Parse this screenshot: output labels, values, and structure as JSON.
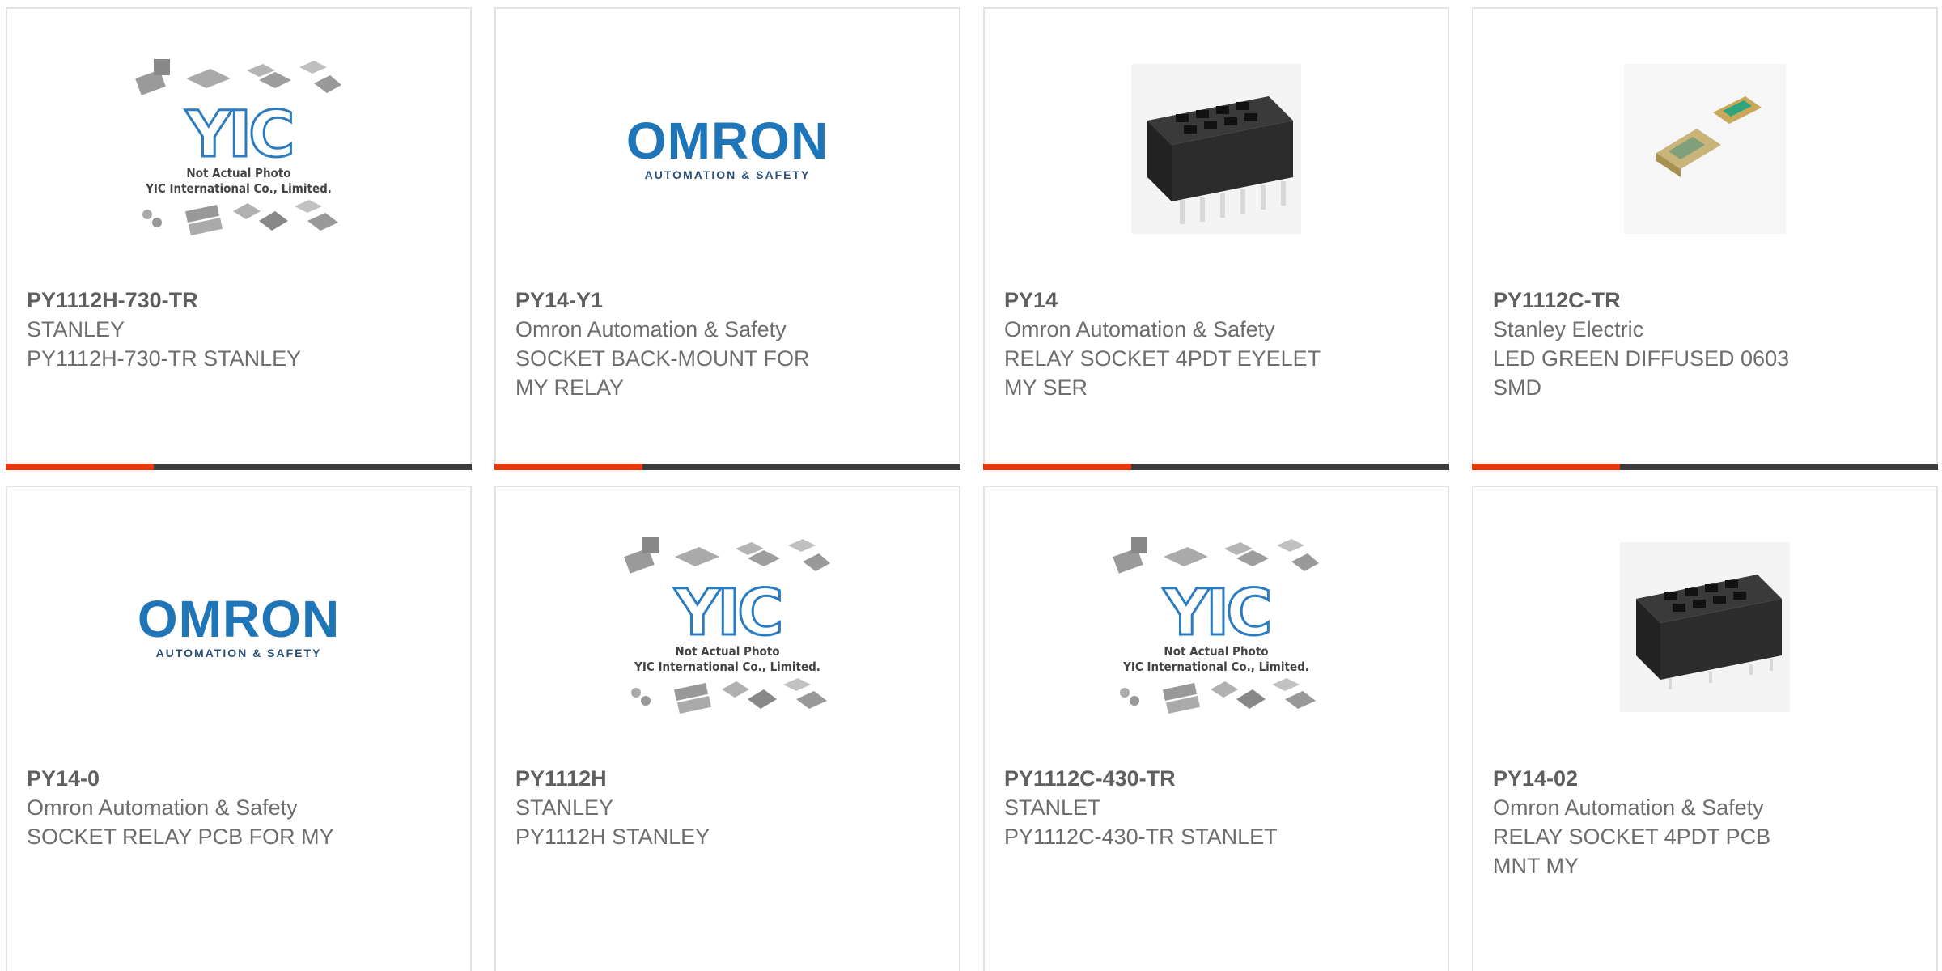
{
  "products": [
    {
      "part": "PY1112H-730-TR",
      "maker": "STANLEY",
      "desc1": "PY1112H-730-TR STANLEY",
      "desc2": "",
      "image": "yic-placeholder-icon"
    },
    {
      "part": "PY14-Y1",
      "maker": "Omron Automation & Safety",
      "desc1": "SOCKET BACK-MOUNT FOR",
      "desc2": "MY RELAY",
      "image": "omron-logo"
    },
    {
      "part": "PY14",
      "maker": "Omron Automation & Safety",
      "desc1": "RELAY SOCKET 4PDT EYELET",
      "desc2": "MY SER",
      "image": "relay-socket-photo"
    },
    {
      "part": "PY1112C-TR",
      "maker": "Stanley Electric",
      "desc1": "LED GREEN DIFFUSED 0603",
      "desc2": "SMD",
      "image": "led-photo"
    },
    {
      "part": "PY14-0",
      "maker": "Omron Automation & Safety",
      "desc1": "SOCKET RELAY PCB FOR MY",
      "desc2": "",
      "image": "omron-logo"
    },
    {
      "part": "PY1112H",
      "maker": "STANLEY",
      "desc1": "PY1112H STANLEY",
      "desc2": "",
      "image": "yic-placeholder-icon"
    },
    {
      "part": "PY1112C-430-TR",
      "maker": "STANLET",
      "desc1": "PY1112C-430-TR STANLET",
      "desc2": "",
      "image": "yic-placeholder-icon"
    },
    {
      "part": "PY14-02",
      "maker": "Omron Automation & Safety",
      "desc1": "RELAY SOCKET 4PDT PCB",
      "desc2": "MNT MY",
      "image": "relay-socket-photo"
    }
  ],
  "omron": {
    "word": "OMRON",
    "sub": "AUTOMATION & SAFETY"
  },
  "yic": {
    "letters": "YIC",
    "note1": "Not Actual Photo",
    "note2": "YIC International Co., Limited."
  },
  "colors": {
    "accent": "#e8380d",
    "bar": "#3c3c3c",
    "text": "#6d6d6d",
    "omron": "#1e76b8"
  }
}
